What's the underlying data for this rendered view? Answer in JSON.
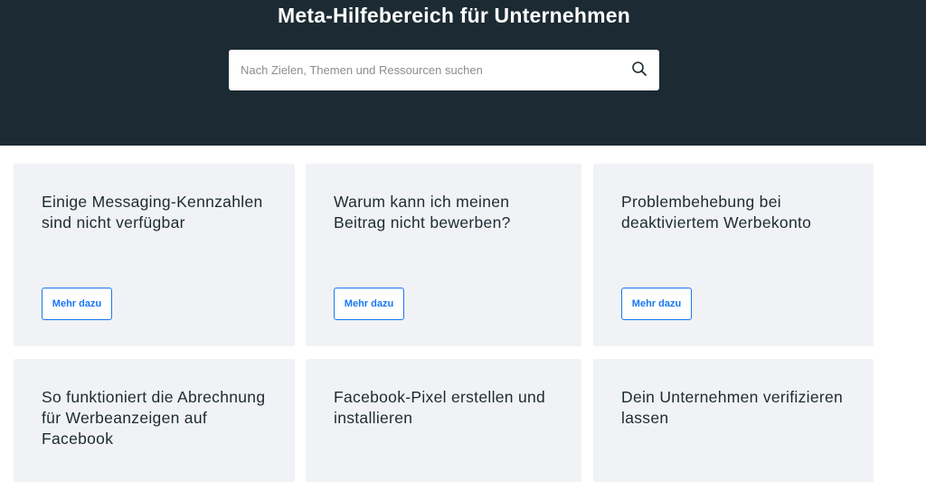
{
  "header": {
    "title": "Meta-Hilfebereich für Unternehmen"
  },
  "search": {
    "placeholder": "Nach Zielen, Themen und Ressourcen suchen",
    "icon": "search-icon"
  },
  "cards": [
    {
      "title": "Einige Messaging-Kennzahlen sind nicht verfügbar",
      "button_label": "Mehr dazu"
    },
    {
      "title": "Warum kann ich meinen Beitrag nicht bewerben?",
      "button_label": "Mehr dazu"
    },
    {
      "title": "Problembehebung bei deaktiviertem Werbekonto",
      "button_label": "Mehr dazu"
    },
    {
      "title": "So funktioniert die Abrechnung für Werbeanzeigen auf Facebook"
    },
    {
      "title": "Facebook-Pixel erstellen und installieren"
    },
    {
      "title": "Dein Unternehmen verifizieren lassen"
    }
  ],
  "colors": {
    "header_bg": "#1c2b33",
    "card_bg": "#f1f2f5",
    "accent": "#1877f2"
  }
}
